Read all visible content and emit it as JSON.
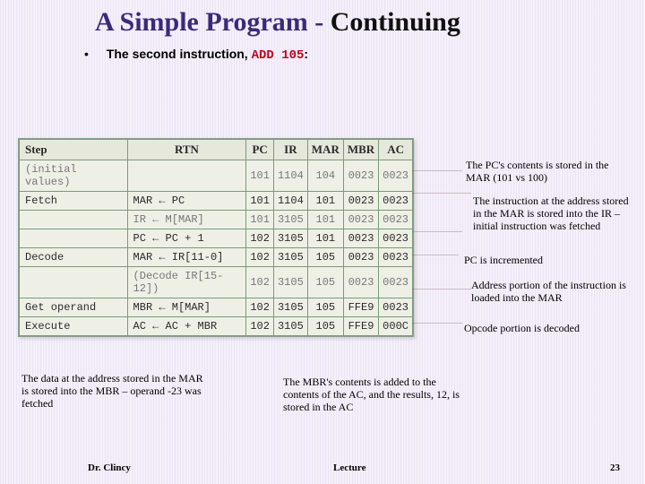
{
  "title": {
    "pre": "A Simple Program - ",
    "post": "Continuing"
  },
  "subline": {
    "bullet": "•",
    "lead": "The second instruction, ",
    "code": "ADD 105",
    "tail": ":"
  },
  "table": {
    "headers": [
      "Step",
      "RTN",
      "PC",
      "IR",
      "MAR",
      "MBR",
      "AC"
    ],
    "rows": [
      {
        "step": "(initial values)",
        "rtn": "",
        "pc": "101",
        "ir": "1104",
        "mar": "104",
        "mbr": "0023",
        "ac": "0023"
      },
      {
        "step": "Fetch",
        "rtn": "MAR ← PC",
        "pc": "101",
        "ir": "1104",
        "mar": "101",
        "mbr": "0023",
        "ac": "0023"
      },
      {
        "step": "",
        "rtn": "IR ← M[MAR]",
        "pc": "101",
        "ir": "3105",
        "mar": "101",
        "mbr": "0023",
        "ac": "0023"
      },
      {
        "step": "",
        "rtn": "PC ← PC + 1",
        "pc": "102",
        "ir": "3105",
        "mar": "101",
        "mbr": "0023",
        "ac": "0023"
      },
      {
        "step": "Decode",
        "rtn": "MAR ← IR[11-0]",
        "pc": "102",
        "ir": "3105",
        "mar": "105",
        "mbr": "0023",
        "ac": "0023"
      },
      {
        "step": "",
        "rtn": "(Decode IR[15-12])",
        "pc": "102",
        "ir": "3105",
        "mar": "105",
        "mbr": "0023",
        "ac": "0023"
      },
      {
        "step": "Get operand",
        "rtn": "MBR ← M[MAR]",
        "pc": "102",
        "ir": "3105",
        "mar": "105",
        "mbr": "FFE9",
        "ac": "0023"
      },
      {
        "step": "Execute",
        "rtn": "AC ← AC + MBR",
        "pc": "102",
        "ir": "3105",
        "mar": "105",
        "mbr": "FFE9",
        "ac": "000C"
      }
    ]
  },
  "annos": {
    "a1": "The PC's contents is stored in the MAR (101 vs 100)",
    "a2": "The instruction at the address stored in the MAR is stored into the IR – initial instruction was fetched",
    "a3": "PC is incremented",
    "a4": "Address portion of the instruction is loaded into the MAR",
    "a5": "Opcode portion is decoded",
    "a6": "The data at the address stored in the MAR is stored into the MBR – operand -23 was fetched",
    "a7": "The MBR's contents is added to the contents of the AC, and the results, 12, is stored in the AC"
  },
  "footer": {
    "left": "Dr. Clincy",
    "mid": "Lecture",
    "page": "23"
  }
}
